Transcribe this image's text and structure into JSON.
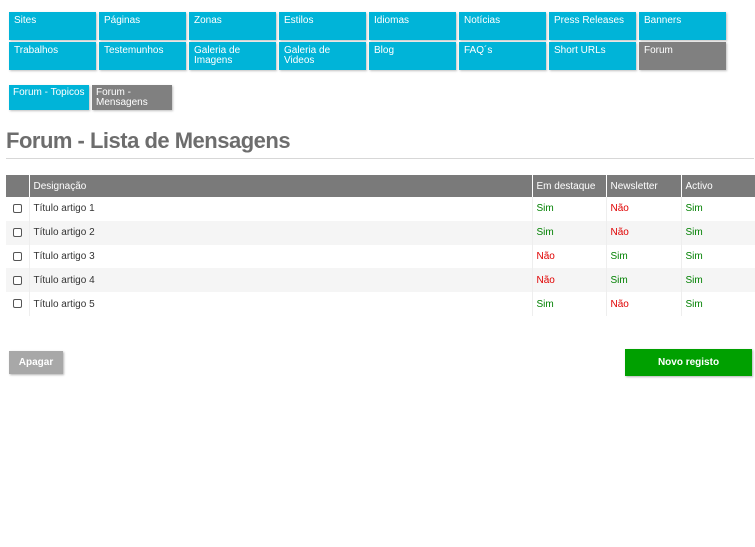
{
  "nav": {
    "items": [
      {
        "label": "Sites",
        "active": false
      },
      {
        "label": "Páginas",
        "active": false
      },
      {
        "label": "Zonas",
        "active": false
      },
      {
        "label": "Estilos",
        "active": false
      },
      {
        "label": "Idiomas",
        "active": false
      },
      {
        "label": "Notícias",
        "active": false
      },
      {
        "label": "Press Releases",
        "active": false
      },
      {
        "label": "Banners",
        "active": false
      },
      {
        "label": "Trabalhos",
        "active": false
      },
      {
        "label": "Testemunhos",
        "active": false
      },
      {
        "label": "Galeria de Imagens",
        "active": false
      },
      {
        "label": "Galeria de Videos",
        "active": false
      },
      {
        "label": "Blog",
        "active": false
      },
      {
        "label": "FAQ´s",
        "active": false
      },
      {
        "label": "Short URLs",
        "active": false
      },
      {
        "label": "Forum",
        "active": true
      }
    ]
  },
  "sub_tabs": [
    {
      "label": "Forum - Topicos",
      "active": false
    },
    {
      "label": "Forum - Mensagens",
      "active": true
    }
  ],
  "page": {
    "title": "Forum - Lista de Mensagens"
  },
  "table": {
    "columns": [
      "Designação",
      "Em destaque",
      "Newsletter",
      "Activo"
    ],
    "rows": [
      {
        "designacao": "Título artigo 1",
        "destaque": "Sim",
        "newsletter": "Não",
        "activo": "Sim"
      },
      {
        "designacao": "Título artigo 2",
        "destaque": "Sim",
        "newsletter": "Não",
        "activo": "Sim"
      },
      {
        "designacao": "Título artigo 3",
        "destaque": "Não",
        "newsletter": "Sim",
        "activo": "Sim"
      },
      {
        "designacao": "Título artigo 4",
        "destaque": "Não",
        "newsletter": "Sim",
        "activo": "Sim"
      },
      {
        "designacao": "Título artigo 5",
        "destaque": "Sim",
        "newsletter": "Não",
        "activo": "Sim"
      }
    ]
  },
  "actions": {
    "delete_label": "Apagar",
    "new_label": "Novo registo"
  },
  "colors": {
    "nav": "#00b4d8",
    "nav_active": "#808080",
    "yes": "#008000",
    "no": "#e00000",
    "primary_button": "#00a000"
  }
}
